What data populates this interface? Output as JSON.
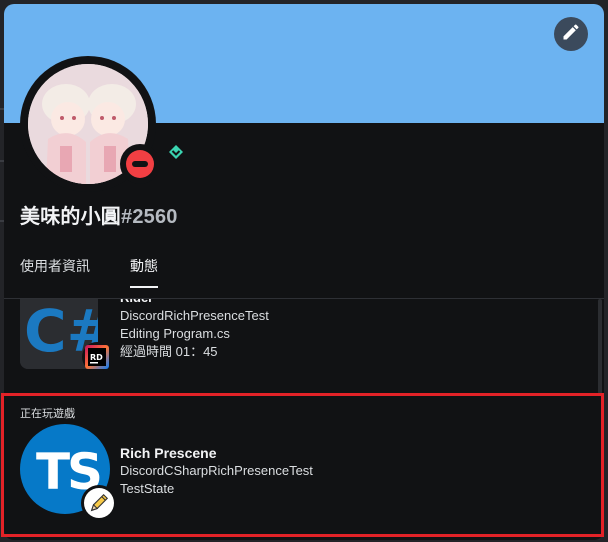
{
  "profile": {
    "username": "美味的小圓",
    "discriminator": "#2560",
    "status": "dnd"
  },
  "tabs": [
    {
      "label": "使用者資訊",
      "active": false
    },
    {
      "label": "動態",
      "active": true
    }
  ],
  "activity1": {
    "title": "Rider",
    "details": "DiscordRichPresenceTest",
    "state": "Editing Program.cs",
    "elapsed": "經過時間 01：45",
    "large_icon": "csharp-icon",
    "small_icon": "rider-icon"
  },
  "activity2": {
    "header": "正在玩遊戲",
    "title": "Rich Prescene",
    "details": "DiscordCSharpRichPresenceTest",
    "state": "TestState",
    "large_icon_text": "TS",
    "small_icon": "pencil-icon"
  },
  "colors": {
    "banner": "#6cb3f1",
    "dnd": "#f23f43",
    "highlight": "#e32227",
    "nitro": "#3bd4b1"
  }
}
